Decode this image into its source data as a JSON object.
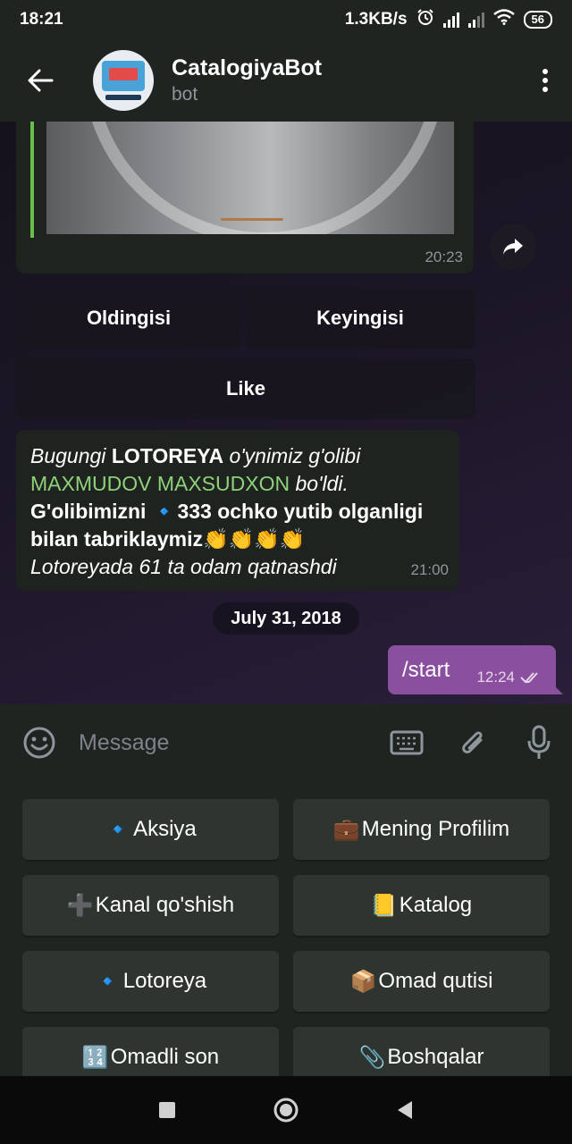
{
  "status_bar": {
    "time": "18:21",
    "speed": "1.3KB/s",
    "battery": "56"
  },
  "header": {
    "title": "CatalogiyaBot",
    "subtitle": "bot"
  },
  "image_message": {
    "time": "20:23"
  },
  "inline_buttons": {
    "prev": "Oldingisi",
    "next": "Keyingisi",
    "like": "Like"
  },
  "lottery_message": {
    "l1a": "Bugungi ",
    "l1b": "LOTOREYA",
    "l1c": " o'ynimiz g'olibi",
    "l2a": "MAXMUDOV MAXSUDXON",
    "l2b": " bo'ldi.",
    "l3a": "G'olibimizni ",
    "l3b": "🔹",
    "l3c": "333 ochko yutib olganligi",
    "l4a": "bilan tabriklaymiz",
    "l4b": "👏👏👏👏",
    "l5": "Lotoreyada 61 ta odam qatnashdi",
    "time": "21:00"
  },
  "date_divider": "July 31, 2018",
  "outgoing_message": {
    "text": "/start",
    "time": "12:24"
  },
  "input": {
    "placeholder": "Message"
  },
  "keyboard": {
    "b1": {
      "emoji": "🔹",
      "label": "Aksiya"
    },
    "b2": {
      "emoji": "💼",
      "label": "Mening Profilim"
    },
    "b3": {
      "emoji": "➕",
      "label": "Kanal qo'shish"
    },
    "b4": {
      "emoji": "📒",
      "label": "Katalog"
    },
    "b5": {
      "emoji": "🔹",
      "label": "Lotoreya"
    },
    "b6": {
      "emoji": "📦",
      "label": "Omad qutisi"
    },
    "b7": {
      "emoji": "🔢",
      "label": "Omadli son"
    },
    "b8": {
      "emoji": "📎",
      "label": "Boshqalar"
    }
  },
  "colors": {
    "accent_green": "#8fd07a",
    "outgoing_bubble": "#8b4fa0",
    "header_bg": "#1f2420"
  }
}
